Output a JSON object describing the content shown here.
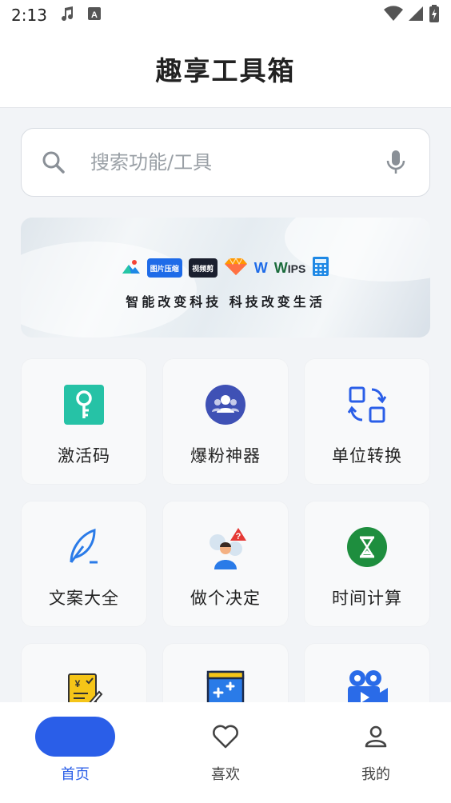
{
  "status_bar": {
    "time": "2:13"
  },
  "header": {
    "title": "趣享工具箱"
  },
  "search": {
    "placeholder": "搜索功能/工具"
  },
  "banner": {
    "logos": [
      "图片压缩",
      "视频剪"
    ],
    "wps_text": "W",
    "ips_text": "IPS",
    "slogan": "智能改变科技  科技改变生活"
  },
  "tools": [
    {
      "label": "激活码",
      "icon": "key-icon",
      "color": "#26c2a6"
    },
    {
      "label": "爆粉神器",
      "icon": "group-icon",
      "color": "#3f51b5"
    },
    {
      "label": "单位转换",
      "icon": "convert-icon",
      "color": "#2a5ee8"
    },
    {
      "label": "文案大全",
      "icon": "feather-pen-icon",
      "color": "#2a7be8"
    },
    {
      "label": "做个决定",
      "icon": "thinking-person-icon",
      "color": "#e53935"
    },
    {
      "label": "时间计算",
      "icon": "hourglass-icon",
      "color": "#1e8e3e"
    },
    {
      "label": "",
      "icon": "invoice-icon",
      "color": "#f5c518"
    },
    {
      "label": "",
      "icon": "calculator-box-icon",
      "color": "#2a7be8"
    },
    {
      "label": "",
      "icon": "video-camera-icon",
      "color": "#2a6be8"
    }
  ],
  "nav": {
    "active_color": "#2a5ee8",
    "items": [
      {
        "label": "首页",
        "icon": "home-icon"
      },
      {
        "label": "喜欢",
        "icon": "heart-icon"
      },
      {
        "label": "我的",
        "icon": "profile-icon"
      }
    ]
  }
}
